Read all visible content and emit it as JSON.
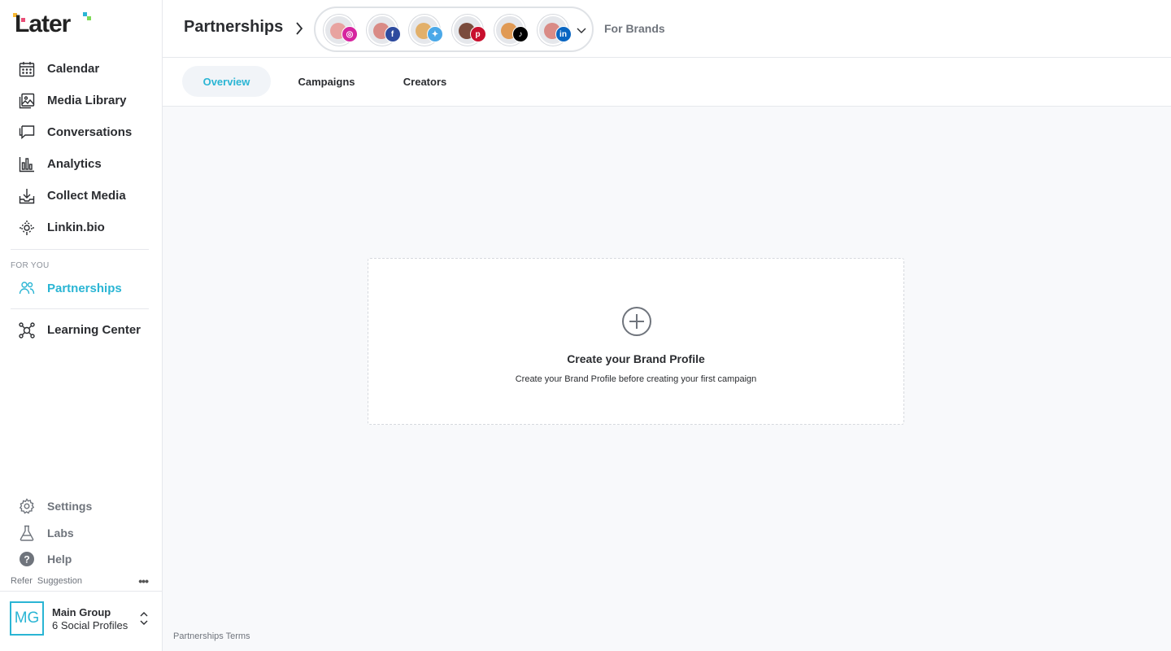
{
  "brand": {
    "logo_text": "Later",
    "accent": "#2ab5d4"
  },
  "sidebar": {
    "items": [
      {
        "label": "Calendar",
        "icon": "calendar-icon"
      },
      {
        "label": "Media Library",
        "icon": "image-icon"
      },
      {
        "label": "Conversations",
        "icon": "chat-icon"
      },
      {
        "label": "Analytics",
        "icon": "bar-chart-icon"
      },
      {
        "label": "Collect Media",
        "icon": "download-tray-icon"
      },
      {
        "label": "Linkin.bio",
        "icon": "link-gear-icon"
      }
    ],
    "section_label": "FOR YOU",
    "partnerships": {
      "label": "Partnerships",
      "icon": "people-icon"
    },
    "learning_center": {
      "label": "Learning Center",
      "icon": "network-icon"
    },
    "bottom": [
      {
        "label": "Settings",
        "icon": "gear-icon"
      },
      {
        "label": "Labs",
        "icon": "flask-icon"
      },
      {
        "label": "Help",
        "icon": "help-icon"
      }
    ],
    "refer": "Refer",
    "suggestion": "Suggestion",
    "more": "•••",
    "group": {
      "initials": "MG",
      "name": "Main Group",
      "profiles": "6 Social Profiles"
    }
  },
  "header": {
    "title": "Partnerships",
    "for_brands": "For Brands",
    "profiles": [
      {
        "network": "instagram",
        "badge_color": "#d6249f",
        "glyph": "◎"
      },
      {
        "network": "facebook",
        "badge_color": "#2d4a9e",
        "glyph": "f"
      },
      {
        "network": "twitter",
        "badge_color": "#4aa8e8",
        "glyph": "✦"
      },
      {
        "network": "pinterest",
        "badge_color": "#c8102e",
        "glyph": "p"
      },
      {
        "network": "tiktok",
        "badge_color": "#000000",
        "glyph": "♪"
      },
      {
        "network": "linkedin",
        "badge_color": "#0a66c2",
        "glyph": "in"
      }
    ]
  },
  "tabs": [
    {
      "label": "Overview",
      "active": true
    },
    {
      "label": "Campaigns",
      "active": false
    },
    {
      "label": "Creators",
      "active": false
    }
  ],
  "main": {
    "empty_title": "Create your Brand Profile",
    "empty_sub": "Create your Brand Profile before creating your first campaign",
    "terms": "Partnerships Terms"
  }
}
